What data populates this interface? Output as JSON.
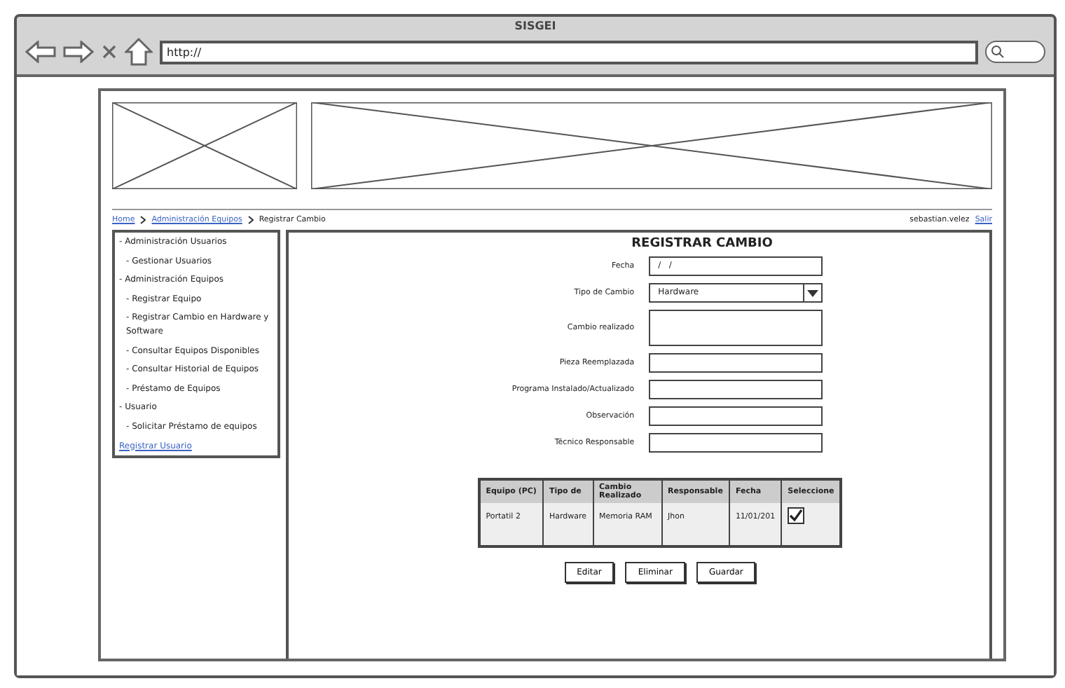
{
  "window": {
    "title": "SISGEI",
    "url": "http://"
  },
  "breadcrumb": [
    "Home",
    "Administración Equipos",
    "Registrar Cambio"
  ],
  "user": {
    "name": "sebastian.velez",
    "logout": "Salir"
  },
  "sidebar": {
    "items": [
      {
        "label": "- Administración Usuarios",
        "children": [
          {
            "label": "- Gestionar Usuarios"
          }
        ]
      },
      {
        "label": "- Administración Equipos",
        "children": [
          {
            "label": "- Registrar Equipo"
          },
          {
            "label": "- Registrar Cambio en Hardware y Software"
          },
          {
            "label": "- Consultar Equipos Disponibles"
          },
          {
            "label": "- Consultar Historial de Equipos"
          },
          {
            "label": "- Préstamo de Equipos"
          }
        ]
      },
      {
        "label": "- Usuario",
        "children": [
          {
            "label": "- Solicitar Préstamo de equipos"
          }
        ]
      }
    ],
    "link": "Registrar Usuario"
  },
  "form": {
    "title": "REGISTRAR CAMBIO",
    "fields": [
      {
        "kind": "date",
        "label": "Fecha",
        "value": "/   /"
      },
      {
        "kind": "select",
        "label": "Tipo de Cambio",
        "value": "Hardware"
      },
      {
        "kind": "textarea",
        "label": "Cambio realizado"
      },
      {
        "kind": "text",
        "label": "Pieza Reemplazada"
      },
      {
        "kind": "text",
        "label": "Programa Instalado/Actualizado"
      },
      {
        "kind": "text",
        "label": "Observación"
      },
      {
        "kind": "text",
        "label": "Técnico Responsable"
      }
    ]
  },
  "table": {
    "columns": [
      "Equipo (PC)",
      "Tipo de",
      "Cambio Realizado",
      "Responsable",
      "Fecha",
      "Seleccione"
    ],
    "rows": [
      {
        "cells": [
          "Portatil 2",
          "Hardware",
          "Memoria RAM",
          "Jhon",
          "11/01/201"
        ],
        "checked": true
      }
    ]
  },
  "buttons": [
    "Editar",
    "Eliminar",
    "Guardar"
  ]
}
